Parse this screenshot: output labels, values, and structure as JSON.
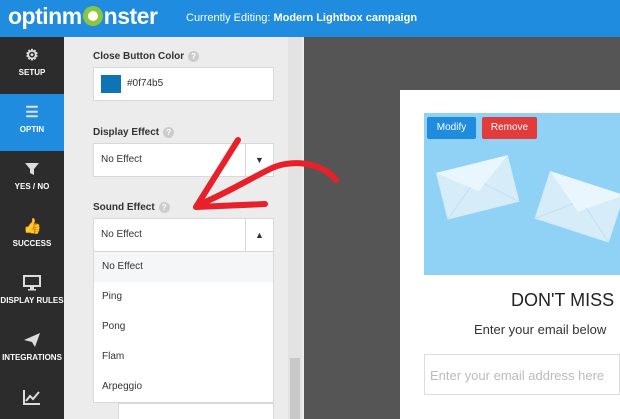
{
  "header": {
    "logo_text_left": "optinm",
    "logo_text_right": "nster",
    "editing_label": "Currently Editing:",
    "campaign_name": "Modern Lightbox campaign"
  },
  "sidebar": {
    "items": [
      {
        "label": "SETUP",
        "icon": "gear-icon",
        "active": false
      },
      {
        "label": "OPTIN",
        "icon": "menu-icon",
        "active": true
      },
      {
        "label": "YES / NO",
        "icon": "filter-icon",
        "active": false
      },
      {
        "label": "SUCCESS",
        "icon": "thumbs-up-icon",
        "active": false
      },
      {
        "label": "DISPLAY RULES",
        "icon": "monitor-icon",
        "active": false
      },
      {
        "label": "INTEGRATIONS",
        "icon": "paper-plane-icon",
        "active": false
      },
      {
        "label": "",
        "icon": "chart-icon",
        "active": false
      }
    ]
  },
  "panel": {
    "close_button_color": {
      "label": "Close Button Color",
      "value": "#0f74b5"
    },
    "display_effect": {
      "label": "Display Effect",
      "value": "No Effect"
    },
    "sound_effect": {
      "label": "Sound Effect",
      "value": "No Effect",
      "options": [
        "No Effect",
        "Ping",
        "Pong",
        "Flam",
        "Arpeggio"
      ]
    }
  },
  "preview": {
    "modify_label": "Modify",
    "remove_label": "Remove",
    "headline": "DON'T MISS",
    "subtext": "Enter your email below",
    "email_placeholder": "Enter your email address here"
  },
  "colors": {
    "accent": "#1f8ce0",
    "remove": "#e23b3b",
    "annotation_arrow": "#e8202a",
    "hero": "#8fd2f5"
  }
}
